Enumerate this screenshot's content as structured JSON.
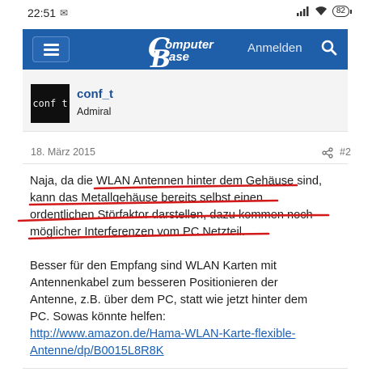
{
  "status_bar": {
    "time": "22:51",
    "mail_icon": "mail-icon",
    "battery": "82"
  },
  "header": {
    "menu_icon": "hamburger-menu-icon",
    "logo_line1": "omputer",
    "logo_line2": "ase",
    "logo_letter1": "C",
    "logo_letter2": "B",
    "login_label": "Anmelden",
    "search_icon": "search-icon",
    "brand_color": "#1f5ea8"
  },
  "post": {
    "avatar_text": "conf t",
    "username": "conf_t",
    "rank": "Admiral",
    "date": "18. März 2015",
    "post_number": "#2",
    "share_icon": "share-icon",
    "paragraph1": [
      [
        "Naja, da die ",
        "WLAN Antennen hinter dem Gehäuse",
        " sind,"
      ],
      [
        "kann das Metallgehäuse bereits selbst einen"
      ],
      [
        "ordentlichen Störfaktor darstellen, dazu kommen noch"
      ],
      [
        "möglicher Interferenzen vom PC Netzteil."
      ]
    ],
    "paragraph2": [
      "Besser für den Empfang sind WLAN Karten mit",
      "Antennenkabel zum besseren Positionieren der",
      "Antenne, z.B. über dem PC, statt wie jetzt hinter dem",
      "PC. Sowas könnte helfen:"
    ],
    "link_lines": [
      "http://www.amazon.de/Hama-WLAN-Karte-flexible-",
      "Antenne/dp/B0015L8R8K"
    ],
    "annotation_color": "#d31a1a"
  }
}
